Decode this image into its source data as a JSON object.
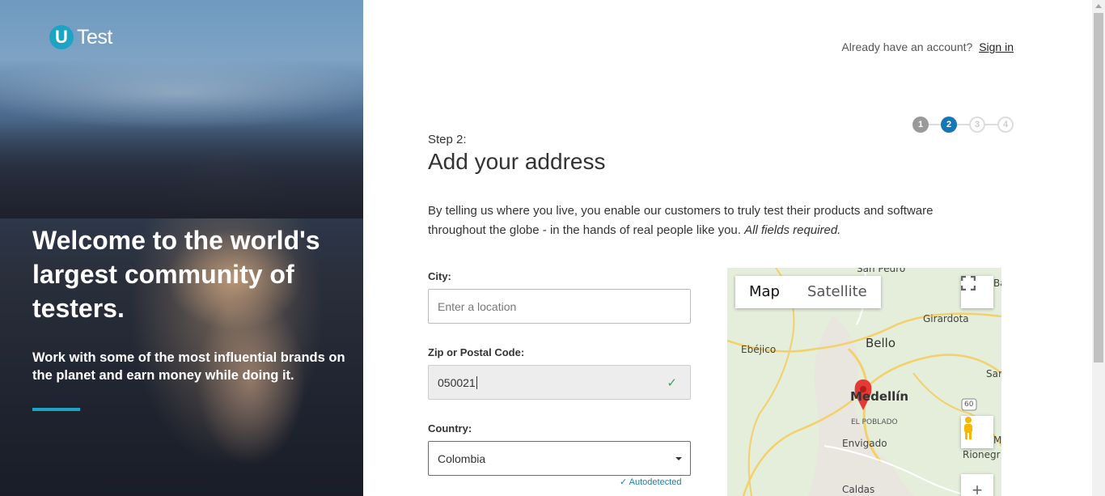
{
  "logo": {
    "mark": "U",
    "text": "Test"
  },
  "hero": {
    "title": "Welcome to the world's largest community of testers.",
    "subtitle": "Work with some of the most influential brands on the planet and earn money while doing it."
  },
  "header": {
    "account_prompt": "Already have an account?",
    "signin_label": "Sign in"
  },
  "stepper": {
    "steps": [
      "1",
      "2",
      "3",
      "4"
    ],
    "current": 2
  },
  "form": {
    "step_label": "Step 2:",
    "title": "Add your address",
    "intro": "By telling us where you live, you enable our customers to truly test their products and software throughout the globe - in the hands of real people like you.",
    "intro_note": "All fields required.",
    "city": {
      "label": "City:",
      "placeholder": "Enter a location",
      "value": ""
    },
    "zip": {
      "label": "Zip or Postal Code:",
      "value": "050021"
    },
    "country": {
      "label": "Country:",
      "value": "Colombia",
      "autodetected": "Autodetected"
    }
  },
  "map": {
    "tabs": [
      "Map",
      "Satellite"
    ],
    "active_tab": "Map",
    "places": [
      "San Pedro",
      "Girardota",
      "Bello",
      "Ebéjico",
      "Medellín",
      "EL POBLADO",
      "Envigado",
      "Rionegr",
      "Caldas",
      "San",
      "Ba",
      "Ma"
    ],
    "route_number": "60",
    "zoom_in": "+",
    "icons": [
      "fullscreen-icon",
      "pegman-icon",
      "map-pin-icon"
    ]
  },
  "colors": {
    "accent": "#1ea3c4",
    "step_active": "#1577b5",
    "check": "#3aa35a",
    "pin": "#e53935"
  }
}
